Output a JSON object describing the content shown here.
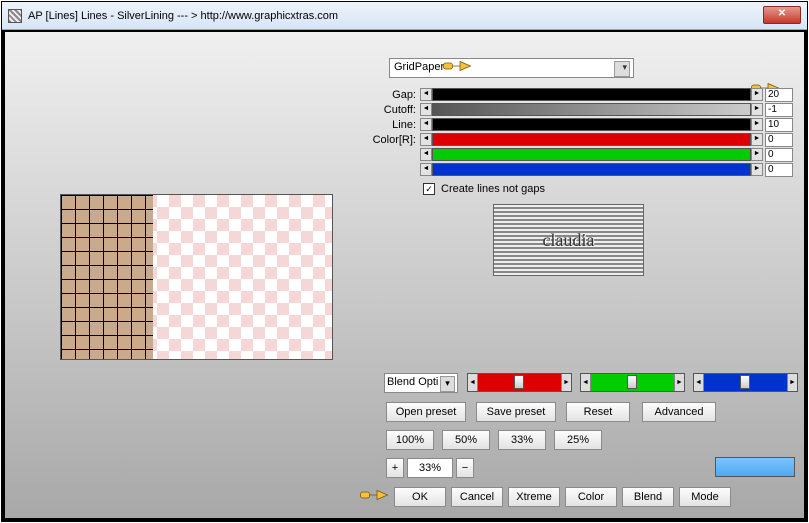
{
  "window": {
    "title": "AP [Lines]  Lines - SilverLining   --- > http://www.graphicxtras.com"
  },
  "preset": {
    "value": "GridPaper"
  },
  "params": {
    "gap_label": "Gap:",
    "gap_value": "20",
    "cutoff_label": "Cutoff:",
    "cutoff_value": "-1",
    "line_label": "Line:",
    "line_value": "10",
    "colorR_label": "Color[R]:",
    "colorR_value": "0",
    "colorG_value": "0",
    "colorB_value": "0"
  },
  "checkbox": {
    "label": "Create lines not gaps",
    "checked": "✓"
  },
  "logo": {
    "text": "claudia"
  },
  "blend": {
    "value": "Blend Opti"
  },
  "buttons": {
    "open": "Open preset",
    "save": "Save preset",
    "reset": "Reset",
    "adv": "Advanced",
    "p100": "100%",
    "p50": "50%",
    "p33": "33%",
    "p25": "25%",
    "plus": "+",
    "minus": "−",
    "ok": "OK",
    "cancel": "Cancel",
    "xtreme": "Xtreme",
    "color": "Color",
    "blend": "Blend",
    "mode": "Mode"
  },
  "zoom": {
    "value": "33%"
  }
}
